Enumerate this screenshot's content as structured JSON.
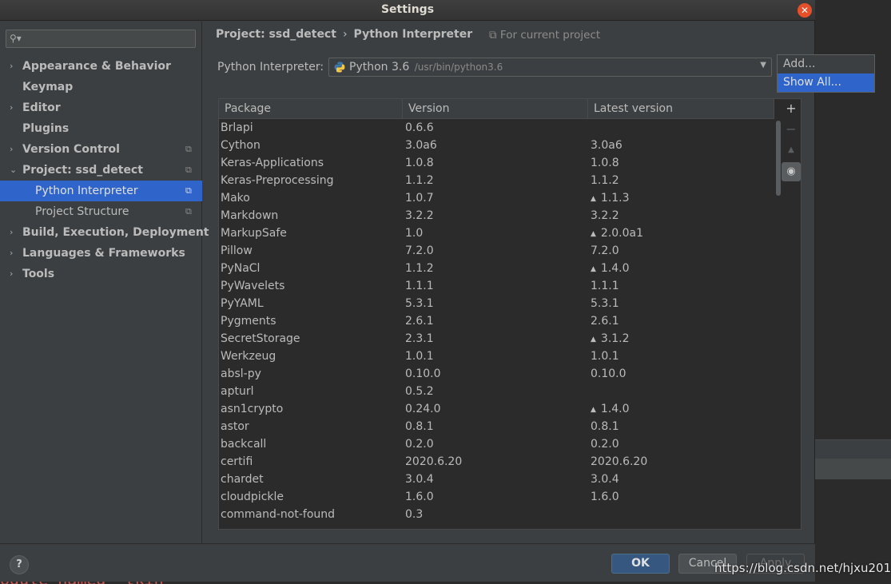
{
  "window": {
    "title": "Settings"
  },
  "sidebar": {
    "search_placeholder": "",
    "items": [
      {
        "label": "Appearance & Behavior",
        "arrow": "›",
        "icon": ""
      },
      {
        "label": "Keymap",
        "arrow": "",
        "icon": ""
      },
      {
        "label": "Editor",
        "arrow": "›",
        "icon": ""
      },
      {
        "label": "Plugins",
        "arrow": "",
        "icon": ""
      },
      {
        "label": "Version Control",
        "arrow": "›",
        "icon": "⧉"
      },
      {
        "label": "Project: ssd_detect",
        "arrow": "⌄",
        "icon": "⧉"
      },
      {
        "label": "Python Interpreter",
        "arrow": "",
        "icon": "⧉"
      },
      {
        "label": "Project Structure",
        "arrow": "",
        "icon": "⧉"
      },
      {
        "label": "Build, Execution, Deployment",
        "arrow": "›",
        "icon": ""
      },
      {
        "label": "Languages & Frameworks",
        "arrow": "›",
        "icon": ""
      },
      {
        "label": "Tools",
        "arrow": "›",
        "icon": ""
      }
    ]
  },
  "breadcrumb": {
    "project": "Project: ssd_detect",
    "separator": "›",
    "page": "Python Interpreter",
    "note": "⧉ For current project"
  },
  "interpreter": {
    "label": "Python Interpreter:",
    "name": "Python 3.6",
    "path": "/usr/bin/python3.6"
  },
  "popup": {
    "options": [
      "Add...",
      "Show All..."
    ]
  },
  "table": {
    "headers": [
      "Package",
      "Version",
      "Latest version"
    ],
    "rows": [
      {
        "package": "Brlapi",
        "version": "0.6.6",
        "latest": "",
        "upgrade": false
      },
      {
        "package": "Cython",
        "version": "3.0a6",
        "latest": "3.0a6",
        "upgrade": false
      },
      {
        "package": "Keras-Applications",
        "version": "1.0.8",
        "latest": "1.0.8",
        "upgrade": false
      },
      {
        "package": "Keras-Preprocessing",
        "version": "1.1.2",
        "latest": "1.1.2",
        "upgrade": false
      },
      {
        "package": "Mako",
        "version": "1.0.7",
        "latest": "1.1.3",
        "upgrade": true
      },
      {
        "package": "Markdown",
        "version": "3.2.2",
        "latest": "3.2.2",
        "upgrade": false
      },
      {
        "package": "MarkupSafe",
        "version": "1.0",
        "latest": "2.0.0a1",
        "upgrade": true
      },
      {
        "package": "Pillow",
        "version": "7.2.0",
        "latest": "7.2.0",
        "upgrade": false
      },
      {
        "package": "PyNaCl",
        "version": "1.1.2",
        "latest": "1.4.0",
        "upgrade": true
      },
      {
        "package": "PyWavelets",
        "version": "1.1.1",
        "latest": "1.1.1",
        "upgrade": false
      },
      {
        "package": "PyYAML",
        "version": "5.3.1",
        "latest": "5.3.1",
        "upgrade": false
      },
      {
        "package": "Pygments",
        "version": "2.6.1",
        "latest": "2.6.1",
        "upgrade": false
      },
      {
        "package": "SecretStorage",
        "version": "2.3.1",
        "latest": "3.1.2",
        "upgrade": true
      },
      {
        "package": "Werkzeug",
        "version": "1.0.1",
        "latest": "1.0.1",
        "upgrade": false
      },
      {
        "package": "absl-py",
        "version": "0.10.0",
        "latest": "0.10.0",
        "upgrade": false
      },
      {
        "package": "apturl",
        "version": "0.5.2",
        "latest": "",
        "upgrade": false
      },
      {
        "package": "asn1crypto",
        "version": "0.24.0",
        "latest": "1.4.0",
        "upgrade": true
      },
      {
        "package": "astor",
        "version": "0.8.1",
        "latest": "0.8.1",
        "upgrade": false
      },
      {
        "package": "backcall",
        "version": "0.2.0",
        "latest": "0.2.0",
        "upgrade": false
      },
      {
        "package": "certifi",
        "version": "2020.6.20",
        "latest": "2020.6.20",
        "upgrade": false
      },
      {
        "package": "chardet",
        "version": "3.0.4",
        "latest": "3.0.4",
        "upgrade": false
      },
      {
        "package": "cloudpickle",
        "version": "1.6.0",
        "latest": "1.6.0",
        "upgrade": false
      },
      {
        "package": "command-not-found",
        "version": "0.3",
        "latest": "",
        "upgrade": false
      }
    ]
  },
  "tools": {
    "add": "+",
    "remove": "−",
    "upgrade": "▲",
    "eye": "👁"
  },
  "footer": {
    "help": "?",
    "ok": "OK",
    "cancel": "Cancel",
    "apply": "Apply"
  },
  "watermark": "https://blog.csdn.net/hjxu2016",
  "background_text": "odule named _tkin",
  "colors": {
    "selection": "#2f65ca",
    "dialog_bg": "#3c3f41",
    "table_bg": "#2b2b2b",
    "close": "#e5502a"
  }
}
